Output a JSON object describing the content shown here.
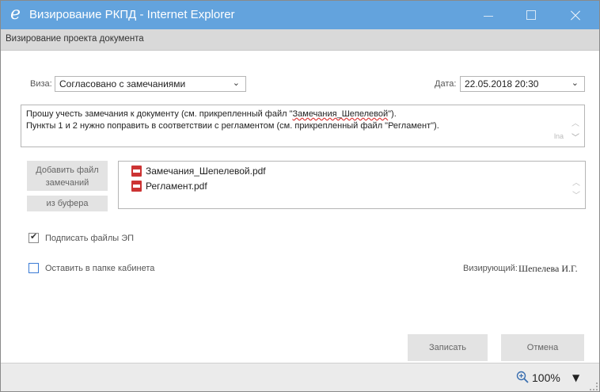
{
  "window": {
    "title": "Визирование РКПД - Internet Explorer",
    "icon": "internet-explorer-icon",
    "title_color": "#63a3dd"
  },
  "subheader": {
    "title": "Визирование проекта документа"
  },
  "form": {
    "visa": {
      "label": "Виза:",
      "value": "Согласовано с замечаниями"
    },
    "date": {
      "label": "Дата:",
      "value": "22.05.2018 20:30"
    },
    "comment": {
      "line1_prefix": "Прошу учесть замечания к документу (см. прикрепленный файл \"",
      "line1_link": "Замечания_Шепелевой",
      "line1_suffix": "\").",
      "line2": "Пункты 1 и 2 нужно поправить в соответствии с регламентом (см. прикрепленный файл \"Регламент\").",
      "resize_mark": "lna"
    },
    "add_file_button": "Добавить файл замечаний",
    "from_buffer_button": "из буфера",
    "files": [
      {
        "name": "Замечания_Шепелевой.pdf",
        "icon": "pdf-icon"
      },
      {
        "name": "Регламент.pdf",
        "icon": "pdf-icon"
      }
    ],
    "sign_files": {
      "label": "Подписать файлы ЭП",
      "checked": true
    },
    "keep_in_folder": {
      "label": "Оставить в папке кабинета",
      "checked": false
    },
    "signer": {
      "label": "Визирующий:",
      "value": "Шепелева И.Г."
    },
    "save_button": "Записать",
    "cancel_button": "Отмена"
  },
  "statusbar": {
    "zoom": "100%",
    "zoom_icon": "zoom-icon"
  }
}
